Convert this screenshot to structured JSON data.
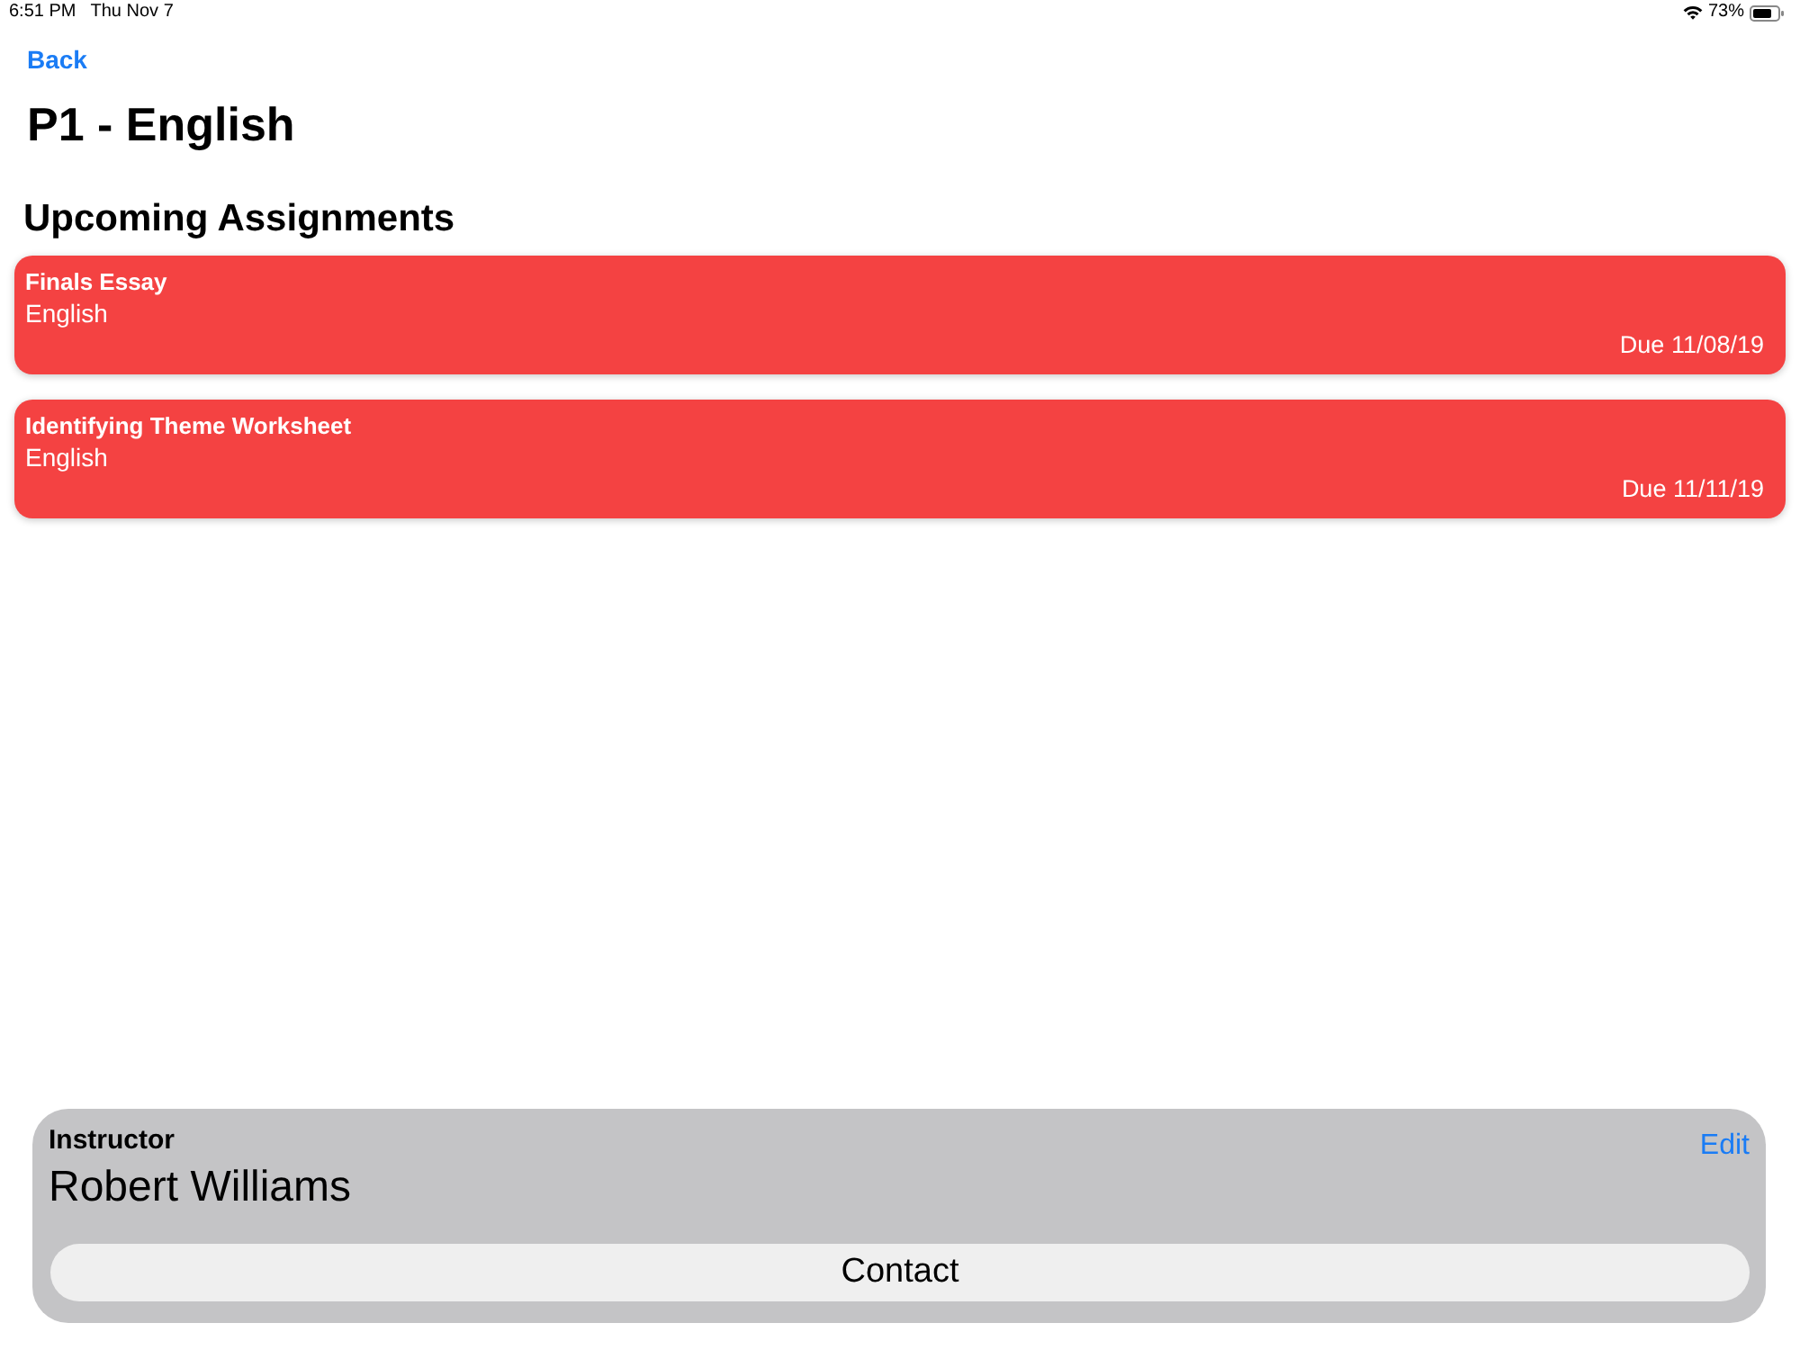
{
  "status_bar": {
    "time": "6:51 PM",
    "date": "Thu Nov 7",
    "battery_text": "73%"
  },
  "nav": {
    "back": "Back"
  },
  "title": "P1 - English",
  "section_title": "Upcoming Assignments",
  "assignments": [
    {
      "title": "Finals Essay",
      "subject": "English",
      "due": "Due 11/08/19"
    },
    {
      "title": "Identifying Theme Worksheet",
      "subject": "English",
      "due": "Due 11/11/19"
    }
  ],
  "instructor": {
    "label": "Instructor",
    "name": "Robert Williams",
    "edit": "Edit",
    "contact": "Contact"
  }
}
